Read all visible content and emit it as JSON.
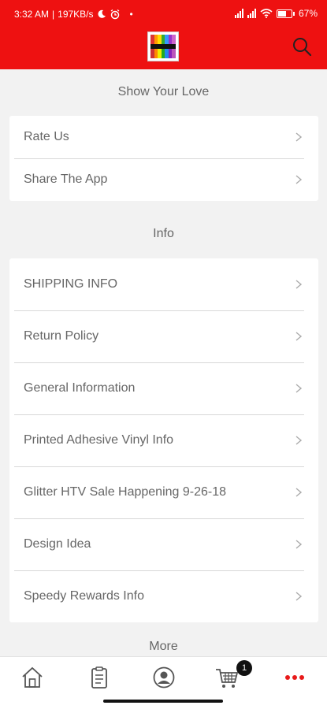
{
  "status_bar": {
    "time": "3:32 AM",
    "speed": "197KB/s",
    "dot": "•",
    "battery_percent": "67%",
    "battery_level": 0.67
  },
  "header": {
    "logo_alt": "app-logo",
    "search_icon": "search-icon"
  },
  "sections": {
    "love_title": "Show Your Love",
    "love_items": [
      "Rate Us",
      "Share The App"
    ],
    "info_title": "Info",
    "info_items": [
      "SHIPPING INFO",
      "Return Policy",
      "General Information",
      "Printed Adhesive Vinyl Info",
      "Glitter HTV Sale Happening 9-26-18",
      "Design Idea",
      "Speedy Rewards Info"
    ],
    "more_title": "More"
  },
  "bottom_nav": {
    "items": [
      "home-icon",
      "orders-icon",
      "account-icon",
      "cart-icon",
      "more-icon"
    ],
    "cart_badge": "1",
    "active_color": "#e81a1a"
  },
  "colors": {
    "brand_red": "#ee1111",
    "background": "#f2f2f2"
  }
}
